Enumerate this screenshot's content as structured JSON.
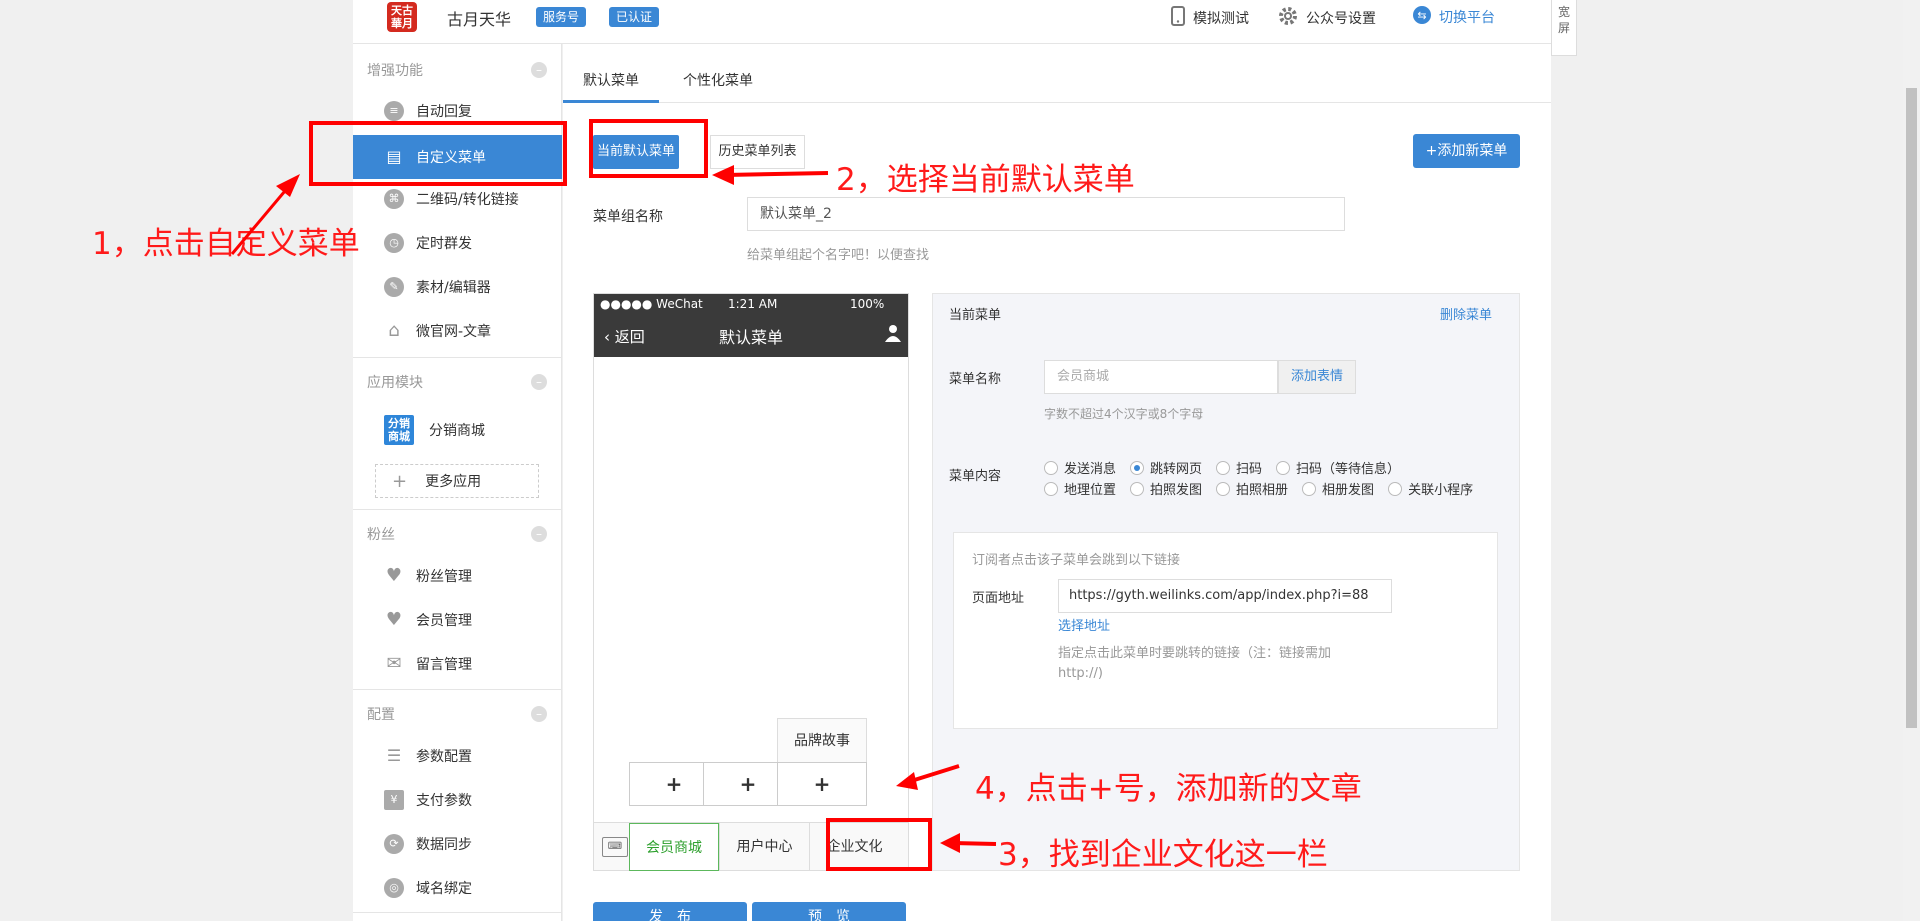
{
  "header": {
    "logo_text": "天古\n華月",
    "brand": "古月天华",
    "badges": [
      "服务号",
      "已认证"
    ],
    "actions": [
      {
        "label": "模拟测试",
        "icon": "phone-icon"
      },
      {
        "label": "公众号设置",
        "icon": "gear-icon"
      },
      {
        "label": "切换平台",
        "icon": "switch-icon"
      }
    ],
    "wide_screen": "宽\n屏"
  },
  "sidebar": {
    "groups": [
      {
        "title": "增强功能",
        "items": [
          {
            "label": "自动回复",
            "icon": "chat-icon"
          },
          {
            "label": "自定义菜单",
            "icon": "edit-menu-icon",
            "active": true
          },
          {
            "label": "二维码/转化链接",
            "icon": "qrcode-icon"
          },
          {
            "label": "定时群发",
            "icon": "clock-icon"
          },
          {
            "label": "素材/编辑器",
            "icon": "pencil-icon"
          },
          {
            "label": "微官网-文章",
            "icon": "home-icon"
          }
        ]
      },
      {
        "title": "应用模块",
        "app": {
          "icon_text": "分销\n商城",
          "label": "分销商城"
        },
        "more": "更多应用"
      },
      {
        "title": "粉丝",
        "items": [
          {
            "label": "粉丝管理",
            "icon": "heart-check-icon"
          },
          {
            "label": "会员管理",
            "icon": "heart-icon"
          },
          {
            "label": "留言管理",
            "icon": "mail-icon"
          }
        ]
      },
      {
        "title": "配置",
        "items": [
          {
            "label": "参数配置",
            "icon": "list-icon"
          },
          {
            "label": "支付参数",
            "icon": "payment-icon"
          },
          {
            "label": "数据同步",
            "icon": "sync-icon"
          },
          {
            "label": "域名绑定",
            "icon": "domain-icon"
          }
        ]
      }
    ]
  },
  "main": {
    "tabs": [
      "默认菜单",
      "个性化菜单"
    ],
    "sub_buttons": {
      "current": "当前默认菜单",
      "history": "历史菜单列表"
    },
    "add_button": "+添加新菜单",
    "group_name_label": "菜单组名称",
    "group_name_value": "默认菜单_2",
    "group_name_hint": "给菜单组起个名字吧！以便查找",
    "publish": "发　布",
    "preview": "预　览"
  },
  "phone": {
    "carrier": "●●●●● WeChat",
    "time": "1:21 AM",
    "battery": "100%",
    "back": "返回",
    "title": "默认菜单",
    "submenu_item": "品牌故事",
    "plus": "+",
    "menus": [
      "会员商城",
      "用户中心",
      "企业文化"
    ]
  },
  "editor": {
    "title": "当前菜单",
    "delete": "删除菜单",
    "name_label": "菜单名称",
    "name_placeholder": "会员商城",
    "emoji_button": "添加表情",
    "name_hint": "字数不超过4个汉字或8个字母",
    "content_label": "菜单内容",
    "options_row1": [
      "发送消息",
      "跳转网页",
      "扫码",
      "扫码（等待信息）"
    ],
    "options_row2": [
      "地理位置",
      "拍照发图",
      "拍照相册",
      "相册发图",
      "关联小程序"
    ],
    "selected_option": "跳转网页",
    "link_tip": "订阅者点击该子菜单会跳到以下链接",
    "url_label": "页面地址",
    "url_value": "https://gyth.weilinks.com/app/index.php?i=88",
    "choose_link": "选择地址",
    "url_hint": "指定点击此菜单时要跳转的链接（注：链接需加http://)"
  },
  "annotations": {
    "step1": "1，点击自定义菜单",
    "step2": "2，选择当前默认菜单",
    "step3": "3，找到企业文化这一栏",
    "step4": "4，点击+号，添加新的文章"
  },
  "colors": {
    "accent": "#3a87d5",
    "annotation": "#ff0000",
    "selected_menu": "#5cb85c"
  }
}
